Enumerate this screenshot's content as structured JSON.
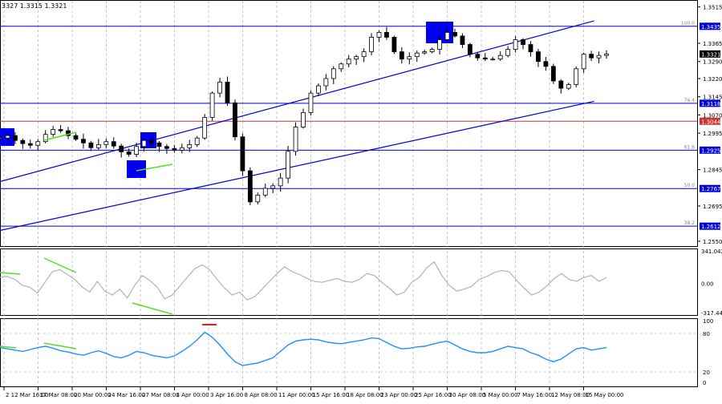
{
  "header_text": "3327 1.3315 1.3321",
  "current_price_label": "1.3321",
  "chart_data": [
    {
      "type": "candlestick",
      "instrument_readout": "3327 1.3315 1.3321",
      "ylim": [
        1.253,
        1.354
      ],
      "y_ticks": [
        "1.3515",
        "1.3365",
        "1.3290",
        "1.3220",
        "1.3145",
        "1.3070",
        "1.2995",
        "1.2845",
        "1.2695",
        "1.2550"
      ],
      "x_labels": [
        "2 12 Mar 16:00",
        "17 Mar 08:00",
        "20 Mar 00:00",
        "24 Mar 16:00",
        "27 Mar 08:00",
        "1 Apr 00:00",
        "3 Apr 16:00",
        "8 Apr 08:00",
        "11 Apr 00:00",
        "15 Apr 16:00",
        "18 Apr 08:00",
        "23 Apr 00:00",
        "25 Apr 16:00",
        "30 Apr 08:00",
        "5 May 00:00",
        "7 May 16:00",
        "12 May 08:00",
        "15 May 00:00"
      ],
      "close_series": [
        1.2975,
        1.2985,
        1.2965,
        1.2952,
        1.2945,
        1.296,
        1.299,
        1.301,
        1.3005,
        1.2985,
        1.297,
        1.2955,
        1.2935,
        1.2948,
        1.296,
        1.2942,
        1.2918,
        1.2908,
        1.294,
        1.2965,
        1.2955,
        1.294,
        1.2932,
        1.2925,
        1.2935,
        1.2948,
        1.2975,
        1.306,
        1.316,
        1.3205,
        1.312,
        1.298,
        1.284,
        1.2712,
        1.274,
        1.2768,
        1.2778,
        1.281,
        1.292,
        1.302,
        1.308,
        1.316,
        1.319,
        1.322,
        1.326,
        1.328,
        1.33,
        1.331,
        1.333,
        1.339,
        1.341,
        1.339,
        1.333,
        1.33,
        1.331,
        1.3325,
        1.333,
        1.334,
        1.338,
        1.341,
        1.3395,
        1.336,
        1.332,
        1.3305,
        1.33,
        1.33,
        1.3315,
        1.334,
        1.338,
        1.336,
        1.333,
        1.329,
        1.327,
        1.321,
        1.318,
        1.3195,
        1.326,
        1.332,
        1.3305,
        1.3315,
        1.3321
      ],
      "horizontal_levels": [
        {
          "label": "100.0",
          "value": "1.3435",
          "price": 1.3435,
          "color": "#0000dd"
        },
        {
          "label": "76.4",
          "value": "1.3118",
          "price": 1.3118,
          "color": "#0000dd"
        },
        {
          "label": "",
          "value": "1.3044",
          "price": 1.3044,
          "color": "#cc3333"
        },
        {
          "label": "61.8",
          "value": "1.2925",
          "price": 1.2925,
          "color": "#0000dd"
        },
        {
          "label": "50.0",
          "value": "1.2767",
          "price": 1.2767,
          "color": "#0000dd"
        },
        {
          "label": "38.2",
          "value": "1.2612",
          "price": 1.2612,
          "color": "#0000dd"
        }
      ],
      "channel_upper": [
        {
          "x": "1 Apr 00:00",
          "y": 1.299
        },
        {
          "x": "15 May 00:00",
          "y": 1.3435
        }
      ],
      "channel_lower": [
        {
          "x": "2 12 Mar 16:00",
          "y": 1.2598
        },
        {
          "x": "15 May 00:00",
          "y": 1.3108
        }
      ]
    },
    {
      "type": "line",
      "indicator": "cci",
      "y_ticks": [
        "341.0423",
        "0.00",
        "-317.444"
      ],
      "ylim": [
        -317.444,
        341.0423
      ],
      "line_color": "#b3b3b3",
      "values": [
        60,
        70,
        40,
        -20,
        -40,
        -100,
        10,
        120,
        140,
        90,
        40,
        -40,
        -90,
        20,
        -80,
        -120,
        -60,
        -150,
        -20,
        80,
        30,
        -40,
        -160,
        -120,
        -30,
        60,
        150,
        190,
        140,
        40,
        -50,
        -120,
        -90,
        -170,
        -140,
        -60,
        20,
        100,
        170,
        120,
        90,
        50,
        20,
        10,
        30,
        50,
        20,
        10,
        40,
        100,
        80,
        10,
        -50,
        -120,
        -90,
        10,
        60,
        160,
        220,
        80,
        -20,
        -80,
        -60,
        -30,
        40,
        70,
        110,
        130,
        120,
        30,
        -50,
        -120,
        -90,
        -30,
        50,
        100,
        40,
        20,
        60,
        80,
        20,
        60
      ]
    },
    {
      "type": "line",
      "indicator": "rsi",
      "y_ticks": [
        "100",
        "80",
        "20",
        "0"
      ],
      "ylim": [
        0,
        100
      ],
      "line_color": "#1e90ff",
      "values": [
        58,
        56,
        54,
        52,
        55,
        58,
        60,
        57,
        53,
        51,
        48,
        46,
        50,
        53,
        49,
        44,
        42,
        46,
        52,
        50,
        46,
        44,
        42,
        45,
        52,
        60,
        70,
        82,
        74,
        62,
        48,
        36,
        30,
        32,
        34,
        38,
        42,
        52,
        62,
        68,
        70,
        71,
        70,
        67,
        65,
        64,
        66,
        68,
        70,
        73,
        72,
        66,
        60,
        56,
        57,
        59,
        60,
        63,
        66,
        68,
        62,
        56,
        52,
        50,
        50,
        52,
        56,
        60,
        58,
        56,
        50,
        46,
        40,
        36,
        40,
        48,
        56,
        58,
        54,
        56,
        58
      ]
    }
  ]
}
